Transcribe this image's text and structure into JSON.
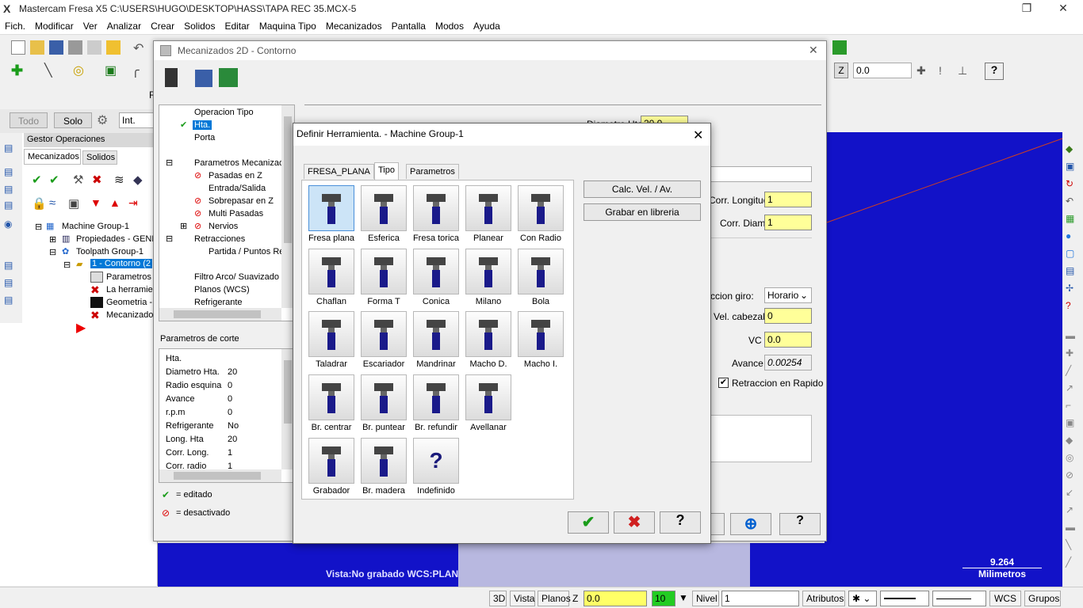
{
  "app": {
    "title": "Mastercam Fresa X5  C:\\USERS\\HUGO\\DESKTOP\\HASS\\TAPA REC 35.MCX-5"
  },
  "menu": [
    "Fich.",
    "Modificar",
    "Ver",
    "Analizar",
    "Crear",
    "Solidos",
    "Editar",
    "Maquina Tipo",
    "Mecanizados",
    "Pantalla",
    "Modos",
    "Ayuda"
  ],
  "toolbar": {
    "z_label": "Z",
    "z_value": "0.0",
    "partial_label": "R"
  },
  "ribbon2": {
    "todo": "Todo",
    "solo": "Solo",
    "int": "Int."
  },
  "ops_manager": {
    "title": "Gestor Operaciones",
    "tabs": [
      "Mecanizados",
      "Solidos"
    ],
    "tree": [
      {
        "label": "Machine Group-1"
      },
      {
        "label": "Propiedades - GENE"
      },
      {
        "label": "Toolpath Group-1"
      },
      {
        "label": "1 - Contorno  (2"
      },
      {
        "label": "Parametros"
      },
      {
        "label": "La herramien"
      },
      {
        "label": "Geometria -"
      },
      {
        "label": "Mecanizado"
      }
    ]
  },
  "dlg1": {
    "title": "Mecanizados 2D - Contorno",
    "nav": [
      "Operacion Tipo",
      "Hta.",
      "Porta",
      "Parametros Mecanizad",
      "Pasadas en Z",
      "Entrada/Salida",
      "Sobrepasar en Z",
      "Multi Pasadas",
      "Nervios",
      "Retracciones",
      "Partida / Puntos Re",
      "Filtro Arco/ Suavizado",
      "Planos (WCS)",
      "Refrigerante"
    ],
    "params_title": "Parametros de corte",
    "params": [
      {
        "k": "Hta.",
        "v": ""
      },
      {
        "k": "Diametro Hta.",
        "v": "20"
      },
      {
        "k": "Radio esquina",
        "v": "0"
      },
      {
        "k": "Avance",
        "v": "0"
      },
      {
        "k": "r.p.m",
        "v": "0"
      },
      {
        "k": "Refrigerante",
        "v": "No"
      },
      {
        "k": "Long. Hta",
        "v": "20"
      },
      {
        "k": "Corr. Long.",
        "v": "1"
      },
      {
        "k": "Corr. radio",
        "v": "1"
      }
    ],
    "legend_edited": "= editado",
    "legend_disabled": "= desactivado",
    "diam_label": "Diametro Hta.",
    "diam_value": "20.0",
    "corr_long_label": "Corr. Longitud",
    "corr_long_value": "1",
    "corr_diam_label": "Corr. Diam.",
    "corr_diam_value": "1",
    "giro_label": "ccion giro:",
    "giro_value": "Horario",
    "cabezal_label": "Vel. cabezal:",
    "cabezal_value": "0",
    "vc_label": "VC",
    "vc_value": "0.0",
    "avance_label": "Avance",
    "avance_value": "0.00254",
    "retraccion_label": "Retraccion en Rapido"
  },
  "dlg2": {
    "title": "Definir Herramienta. - Machine Group-1",
    "tabs": [
      "FRESA_PLANA",
      "Tipo",
      "Parametros"
    ],
    "tools": [
      "Fresa plana",
      "Esferica",
      "Fresa torica",
      "Planear",
      "Con Radio",
      "Chaflan",
      "Forma T",
      "Conica",
      "Milano",
      "Bola",
      "Taladrar",
      "Escariador",
      "Mandrinar",
      "Macho D.",
      "Macho I.",
      "Br. centrar",
      "Br. puntear",
      "Br. refundir",
      "Avellanar",
      "Grabador",
      "Br. madera",
      "Indefinido"
    ],
    "calc_button": "Calc. Vel. / Av.",
    "library_button": "Grabar en libreria"
  },
  "graphics": {
    "view_text": "Vista:No grabado   WCS:PLANTA   Plano C/H:PLANTA",
    "scale_value": "9.264",
    "scale_unit": "Milimetros"
  },
  "statusbar": {
    "b3d": "3D",
    "vista": "Vista",
    "planos": "Planos",
    "z": "Z",
    "z_value": "0.0",
    "color_value": "10",
    "nivel": "Nivel",
    "nivel_value": "1",
    "atributos": "Atributos",
    "wcs": "WCS",
    "grupos": "Grupos"
  },
  "colors": {
    "viewport": "#1212c8",
    "field_yellow": "#ffff99",
    "selection": "#0078d7"
  }
}
